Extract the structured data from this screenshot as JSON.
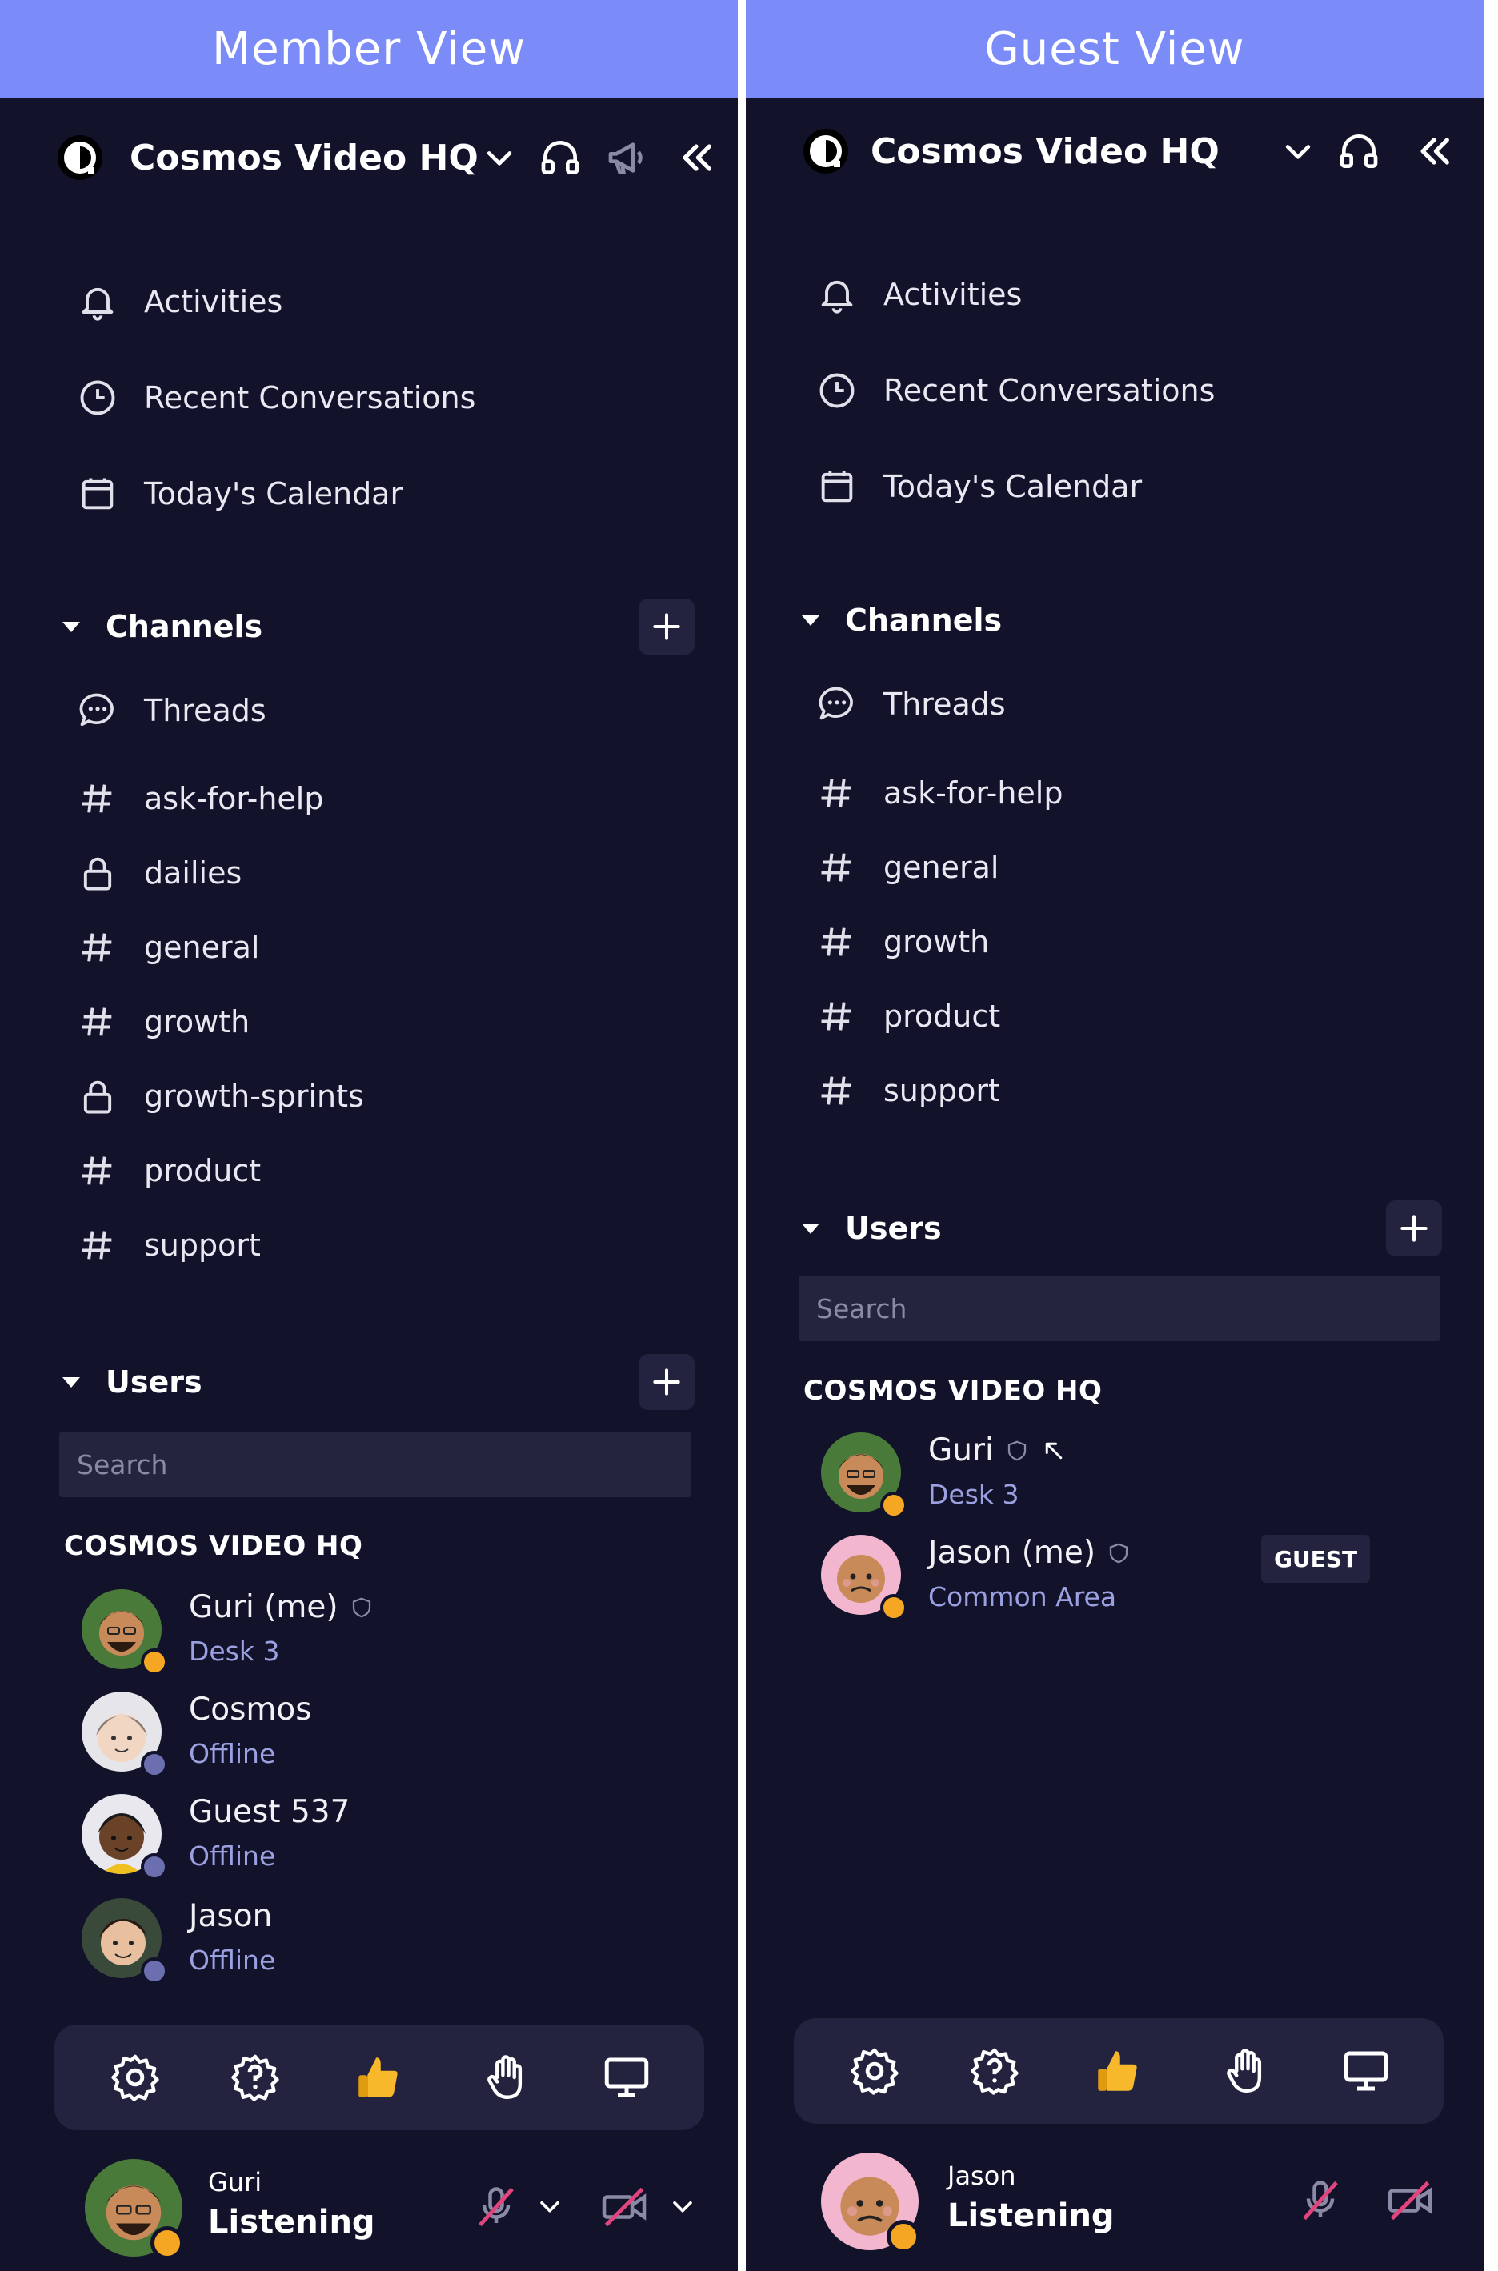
{
  "member": {
    "banner": "Member View",
    "workspace_name": "Cosmos Video HQ",
    "nav": [
      "Activities",
      "Recent Conversations",
      "Today's Calendar"
    ],
    "channels_label": "Channels",
    "channels": [
      "Threads",
      "ask-for-help",
      "dailies",
      "general",
      "growth",
      "growth-sprints",
      "product",
      "support"
    ],
    "users_label": "Users",
    "search_placeholder": "Search",
    "group_label": "COSMOS VIDEO HQ",
    "users": [
      {
        "name": "Guri (me)",
        "sub": "Desk 3"
      },
      {
        "name": "Cosmos",
        "sub": "Offline"
      },
      {
        "name": "Guest 537",
        "sub": "Offline"
      },
      {
        "name": "Jason",
        "sub": "Offline"
      }
    ],
    "me_name": "Guri",
    "me_status": "Listening"
  },
  "guest": {
    "banner": "Guest View",
    "workspace_name": "Cosmos Video HQ",
    "nav": [
      "Activities",
      "Recent Conversations",
      "Today's Calendar"
    ],
    "channels_label": "Channels",
    "channels": [
      "Threads",
      "ask-for-help",
      "general",
      "growth",
      "product",
      "support"
    ],
    "users_label": "Users",
    "search_placeholder": "Search",
    "group_label": "COSMOS VIDEO HQ",
    "users": [
      {
        "name": "Guri",
        "sub": "Desk 3"
      },
      {
        "name": "Jason (me)",
        "sub": "Common Area",
        "badge": "GUEST"
      }
    ],
    "me_name": "Jason",
    "me_status": "Listening"
  },
  "colors": {
    "banner": "#7b8cf8",
    "sidebar_bg": "#12122a",
    "status_online": "#f5a623",
    "status_offline": "#6b6fb0",
    "muted_slash": "#e0457b"
  },
  "icons": [
    "bell-icon",
    "clock-icon",
    "calendar-icon",
    "chat-bubble-icon",
    "hash-icon",
    "lock-icon",
    "plus-icon",
    "headphones-icon",
    "megaphone-icon",
    "collapse-icon",
    "settings-icon",
    "help-icon",
    "thumbs-up-icon",
    "raise-hand-icon",
    "screen-share-icon",
    "mic-off-icon",
    "camera-off-icon"
  ]
}
